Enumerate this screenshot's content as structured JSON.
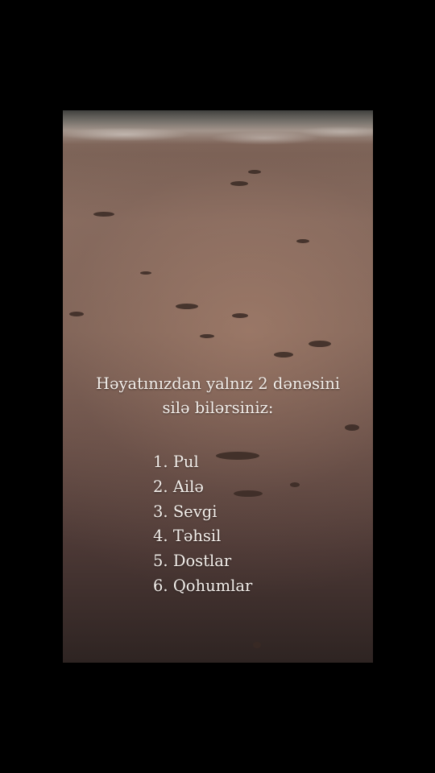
{
  "caption": {
    "line1": "Həyatınızdan yalnız 2 dənəsini",
    "line2": "silə bilərsiniz:"
  },
  "options": [
    {
      "number": "1.",
      "label": "Pul"
    },
    {
      "number": "2.",
      "label": "Ailə"
    },
    {
      "number": "3.",
      "label": "Sevgi"
    },
    {
      "number": "4.",
      "label": "Təhsil"
    },
    {
      "number": "5.",
      "label": "Dostlar"
    },
    {
      "number": "6.",
      "label": "Qohumlar"
    }
  ]
}
